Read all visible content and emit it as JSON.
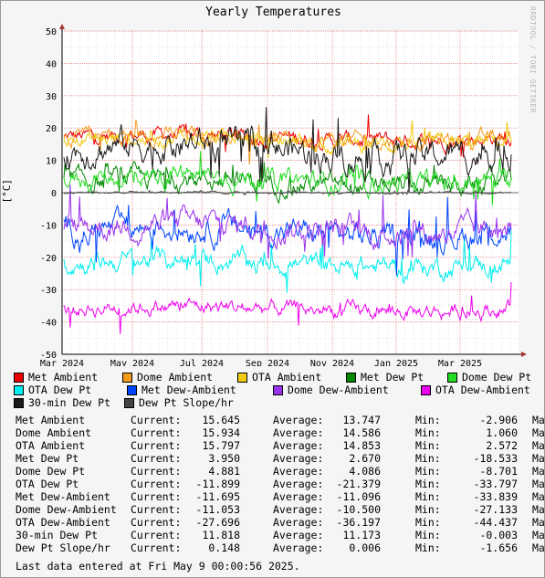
{
  "window": {
    "title": "Yearly Temperatures",
    "watermark": "RRDTOOL / TOBI OETIKER"
  },
  "chart_data": {
    "type": "line",
    "title": "Yearly Temperatures",
    "xlabel": "",
    "ylabel": "[°C]",
    "ylim": [
      -50,
      50
    ],
    "yticks": [
      -50,
      -40,
      -30,
      -20,
      -10,
      0,
      10,
      20,
      30,
      40,
      50
    ],
    "xtick_labels": [
      "Mar 2024",
      "May 2024",
      "Jul 2024",
      "Sep 2024",
      "Nov 2024",
      "Jan 2025",
      "Mar 2025"
    ],
    "grid": true,
    "legend_position": "bottom",
    "series": [
      {
        "name": "Met Ambient",
        "color": "#ee0000",
        "base": 17,
        "spread": 3,
        "current": 15.645,
        "average": 13.747,
        "min": -2.906
      },
      {
        "name": "Dome Ambient",
        "color": "#f49b1d",
        "base": 17,
        "spread": 3,
        "current": 15.934,
        "average": 14.586,
        "min": 1.06
      },
      {
        "name": "OTA Ambient",
        "color": "#f1cc12",
        "base": 16,
        "spread": 3,
        "current": 15.797,
        "average": 14.853,
        "min": 2.572
      },
      {
        "name": "Met Dew Pt",
        "color": "#008800",
        "base": 3,
        "spread": 4,
        "current": 3.95,
        "average": 2.67,
        "min": -18.533
      },
      {
        "name": "Dome Dew Pt",
        "color": "#22dd22",
        "base": 4,
        "spread": 4,
        "current": 4.881,
        "average": 4.086,
        "min": -8.701
      },
      {
        "name": "OTA Dew Pt",
        "color": "#00eeee",
        "base": -22,
        "spread": 4,
        "current": -11.899,
        "average": -21.379,
        "min": -33.797
      },
      {
        "name": "Met Dew-Ambient",
        "color": "#0044ff",
        "base": -12,
        "spread": 5,
        "current": -11.695,
        "average": -11.096,
        "min": -33.839
      },
      {
        "name": "Dome Dew-Ambient",
        "color": "#9933ee",
        "base": -11,
        "spread": 5,
        "current": -11.053,
        "average": -10.5,
        "min": -27.133
      },
      {
        "name": "OTA Dew-Ambient",
        "color": "#ee00ee",
        "base": -36,
        "spread": 3,
        "current": -27.696,
        "average": -36.197,
        "min": -44.437
      },
      {
        "name": "30-min Dew Pt",
        "color": "#1a1a1a",
        "base": 13,
        "spread": 6,
        "current": 11.818,
        "average": 11.173,
        "min": -0.003
      },
      {
        "name": "Dew Pt Slope/hr",
        "color": "#444444",
        "base": 0,
        "spread": 0.4,
        "current": 0.148,
        "average": 0.006,
        "min": -1.656
      }
    ]
  },
  "legend": [
    {
      "label": "Met Ambient",
      "color": "#ee0000"
    },
    {
      "label": "Dome Ambient",
      "color": "#f49b1d"
    },
    {
      "label": "OTA Ambient",
      "color": "#f1cc12"
    },
    {
      "label": "Met Dew Pt",
      "color": "#008800"
    },
    {
      "label": "Dome Dew Pt",
      "color": "#22dd22"
    },
    {
      "label": "OTA Dew Pt",
      "color": "#00eeee"
    },
    {
      "label": "Met Dew-Ambient",
      "color": "#0044ff"
    },
    {
      "label": "Dome Dew-Ambient",
      "color": "#9933ee"
    },
    {
      "label": "OTA Dew-Ambient",
      "color": "#ee00ee"
    },
    {
      "label": "30-min Dew Pt",
      "color": "#1a1a1a"
    },
    {
      "label": "Dew Pt Slope/hr",
      "color": "#444444"
    }
  ],
  "stats_labels": {
    "current": "Current:",
    "average": "Average:",
    "min": "Min:",
    "max": "Ma"
  },
  "stats": [
    {
      "name": "Met Ambient",
      "current": "15.645",
      "average": "13.747",
      "min": "-2.906"
    },
    {
      "name": "Dome Ambient",
      "current": "15.934",
      "average": "14.586",
      "min": "1.060"
    },
    {
      "name": "OTA Ambient",
      "current": "15.797",
      "average": "14.853",
      "min": "2.572"
    },
    {
      "name": "Met Dew Pt",
      "current": "3.950",
      "average": "2.670",
      "min": "-18.533"
    },
    {
      "name": "Dome Dew Pt",
      "current": "4.881",
      "average": "4.086",
      "min": "-8.701"
    },
    {
      "name": "OTA Dew Pt",
      "current": "-11.899",
      "average": "-21.379",
      "min": "-33.797"
    },
    {
      "name": "Met Dew-Ambient",
      "current": "-11.695",
      "average": "-11.096",
      "min": "-33.839"
    },
    {
      "name": "Dome Dew-Ambient",
      "current": "-11.053",
      "average": "-10.500",
      "min": "-27.133"
    },
    {
      "name": "OTA Dew-Ambient",
      "current": "-27.696",
      "average": "-36.197",
      "min": "-44.437"
    },
    {
      "name": "30-min Dew Pt",
      "current": "11.818",
      "average": "11.173",
      "min": "-0.003"
    },
    {
      "name": "Dew Pt Slope/hr",
      "current": "0.148",
      "average": "0.006",
      "min": "-1.656"
    }
  ],
  "footer": "Last data entered at Fri May  9 00:00:56 2025."
}
